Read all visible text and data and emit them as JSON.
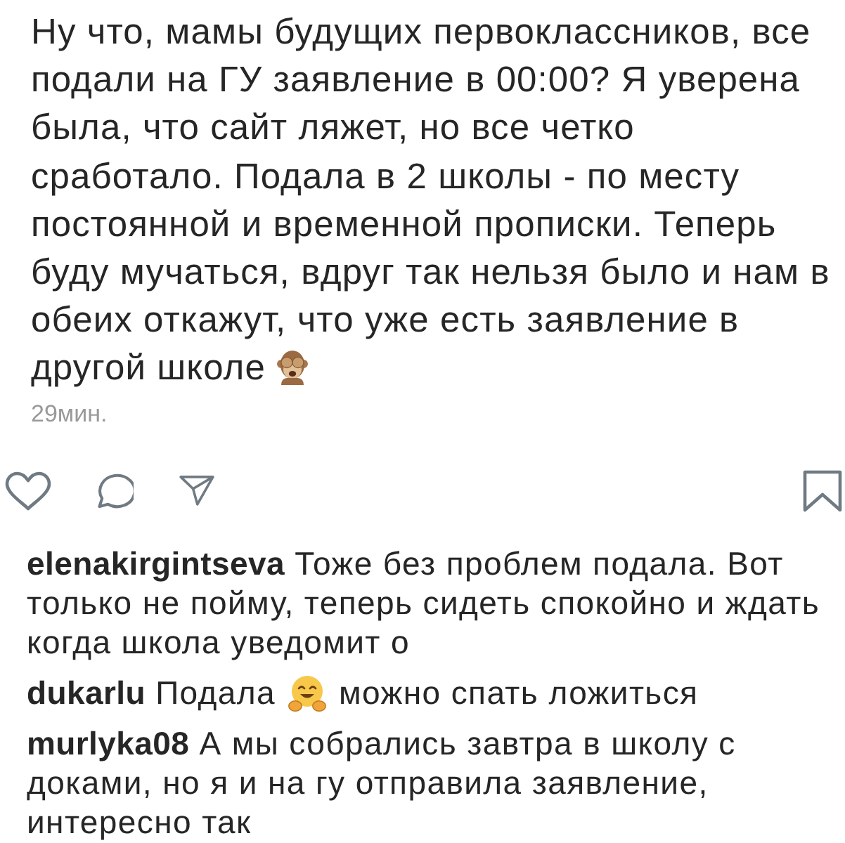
{
  "post": {
    "caption": [
      {
        "kind": "text",
        "text": "Ну что, мамы будущих первоклассников, все подали на ГУ заявление в 00:00? Я уверена была, что сайт ляжет, но все четко сработало. Подала в 2 школы - по месту постоянной и временной прописки. Теперь буду мучаться, вдруг так нельзя было и нам в обеих откажут, что уже есть заявление в другой школе"
      },
      {
        "kind": "monkey"
      }
    ],
    "time": "29мин."
  },
  "comments": [
    {
      "username": "elenakirgintseva",
      "parts": [
        {
          "kind": "text",
          "text": "Тоже без проблем подала. Вот только не пойму, теперь сидеть спокойно и ждать когда школа уведомит о"
        }
      ]
    },
    {
      "username": "dukarlu",
      "parts": [
        {
          "kind": "text",
          "text": "Подала"
        },
        {
          "kind": "hug"
        },
        {
          "kind": "text",
          "text": "можно спать ложиться"
        }
      ]
    },
    {
      "username": "murlyka08",
      "parts": [
        {
          "kind": "text",
          "text": "А мы собрались завтра в школу с доками, но я и на гу отправила заявление, интересно так"
        }
      ]
    }
  ]
}
